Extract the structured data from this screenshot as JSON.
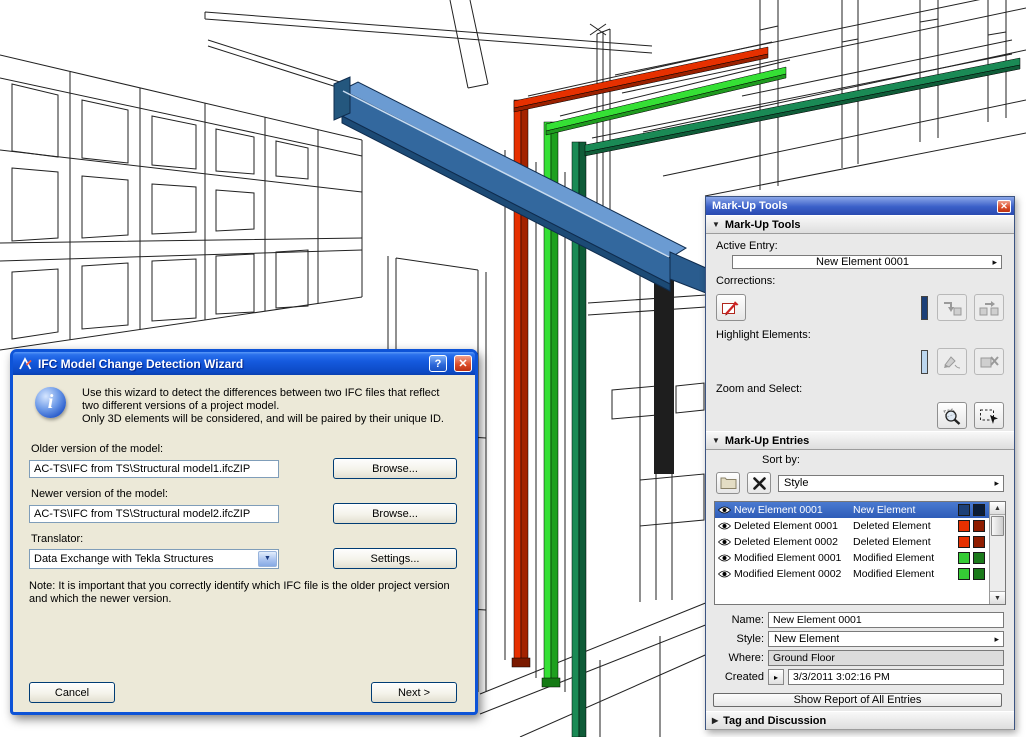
{
  "icons": {
    "collapse": "▼",
    "expand": "▶",
    "popup_arrow": "▸",
    "dropdown": "▼",
    "scroll_up": "▲",
    "scroll_down": "▼"
  },
  "viewport": {
    "description": "3D wireframe model view with mark-up colored beams",
    "beam_colors": {
      "new_element_blue": "#33689e",
      "deleted_red": "#e63000",
      "modified_green": "#35e035",
      "modified_dark_green": "#1a8a55"
    }
  },
  "wizard": {
    "title": "IFC Model Change Detection Wizard",
    "help_icon": "?",
    "close_icon": "✕",
    "intro1": "Use this wizard to detect the differences between two IFC files that reflect two different versions of a project model.",
    "intro2": "Only 3D elements will be considered, and will be paired by their unique ID.",
    "older_label": "Older version of the model:",
    "older_value": "AC-TS\\IFC from TS\\Structural model1.ifcZIP",
    "newer_label": "Newer version of the model:",
    "newer_value": "AC-TS\\IFC from TS\\Structural model2.ifcZIP",
    "browse_label": "Browse...",
    "translator_label": "Translator:",
    "translator_value": "Data Exchange with Tekla Structures",
    "settings_label": "Settings...",
    "note": "Note: It is important that you correctly identify which IFC file is the older project version and which the newer version.",
    "cancel_label": "Cancel",
    "next_label": "Next >"
  },
  "palette": {
    "title": "Mark-Up Tools",
    "close_icon": "✕",
    "sections": {
      "tools": "Mark-Up Tools",
      "entries": "Mark-Up Entries",
      "tag": "Tag and Discussion"
    },
    "active_entry_label": "Active Entry:",
    "active_entry_value": "New Element 0001",
    "corrections_label": "Corrections:",
    "highlight_label": "Highlight Elements:",
    "zoom_label": "Zoom and Select:",
    "highlight_bar_color": "#bcd6ee",
    "sort_by_label": "Sort by:",
    "sort_by_value": "Style",
    "entries": [
      {
        "name": "New Element 0001",
        "style": "New Element",
        "c1": "#1c3f77",
        "c2": "#0a1c38",
        "selected": true
      },
      {
        "name": "Deleted Element 0001",
        "style": "Deleted Element",
        "c1": "#e63000",
        "c2": "#8f1d00",
        "selected": false
      },
      {
        "name": "Deleted Element 0002",
        "style": "Deleted Element",
        "c1": "#e63000",
        "c2": "#8f1d00",
        "selected": false
      },
      {
        "name": "Modified Element 0001",
        "style": "Modified Element",
        "c1": "#35cc35",
        "c2": "#1b7a1b",
        "selected": false
      },
      {
        "name": "Modified Element 0002",
        "style": "Modified Element",
        "c1": "#35cc35",
        "c2": "#1b7a1b",
        "selected": false
      }
    ],
    "name_label": "Name:",
    "name_value": "New Element 0001",
    "style_label": "Style:",
    "style_value": "New Element",
    "where_label": "Where:",
    "where_value": "Ground Floor",
    "created_label": "Created",
    "created_value": "3/3/2011 3:02:16 PM",
    "report_button": "Show Report of All Entries"
  }
}
